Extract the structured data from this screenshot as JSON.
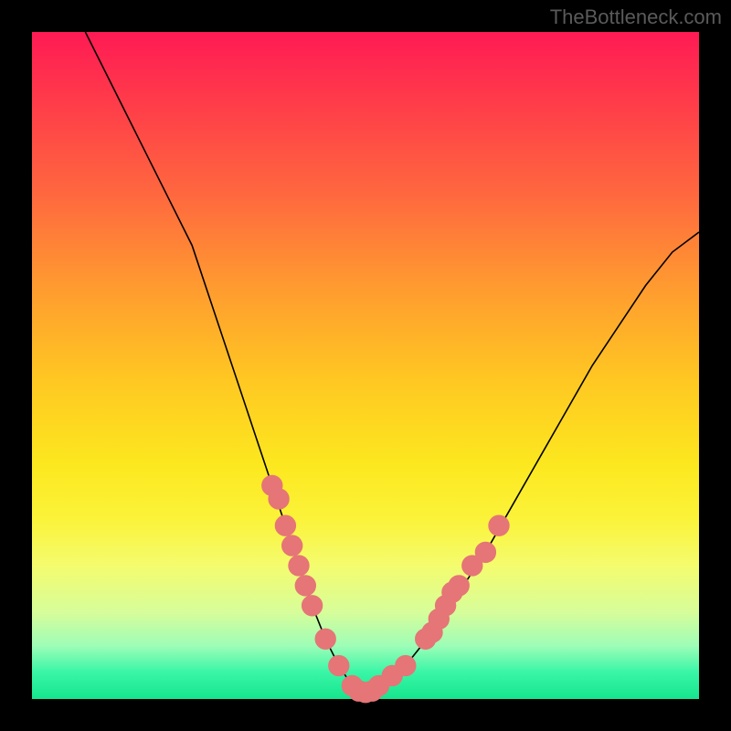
{
  "watermark": "TheBottleneck.com",
  "chart_data": {
    "type": "line",
    "title": "",
    "xlabel": "",
    "ylabel": "",
    "xlim": [
      0,
      100
    ],
    "ylim": [
      0,
      100
    ],
    "series": [
      {
        "name": "curve",
        "x": [
          8,
          12,
          16,
          20,
          24,
          28,
          30,
          32,
          34,
          36,
          38,
          40,
          42,
          44,
          46,
          48,
          50,
          52,
          56,
          60,
          64,
          68,
          72,
          76,
          80,
          84,
          88,
          92,
          96,
          100
        ],
        "y": [
          100,
          92,
          84,
          76,
          68,
          56,
          50,
          44,
          38,
          32,
          26,
          20,
          14,
          9,
          5,
          2,
          1,
          2,
          5,
          10,
          16,
          22,
          29,
          36,
          43,
          50,
          56,
          62,
          67,
          70
        ]
      }
    ],
    "markers": {
      "left_branch": [
        {
          "x": 36,
          "y": 32
        },
        {
          "x": 37,
          "y": 30
        },
        {
          "x": 38,
          "y": 26
        },
        {
          "x": 39,
          "y": 23
        },
        {
          "x": 40,
          "y": 20
        },
        {
          "x": 41,
          "y": 17
        },
        {
          "x": 42,
          "y": 14
        },
        {
          "x": 44,
          "y": 9
        }
      ],
      "bottom": [
        {
          "x": 46,
          "y": 5
        },
        {
          "x": 48,
          "y": 2
        },
        {
          "x": 49,
          "y": 1.2
        },
        {
          "x": 50,
          "y": 1
        },
        {
          "x": 51,
          "y": 1.2
        },
        {
          "x": 52,
          "y": 2
        },
        {
          "x": 54,
          "y": 3.5
        },
        {
          "x": 56,
          "y": 5
        }
      ],
      "right_branch": [
        {
          "x": 59,
          "y": 9
        },
        {
          "x": 60,
          "y": 10
        },
        {
          "x": 61,
          "y": 12
        },
        {
          "x": 62,
          "y": 14
        },
        {
          "x": 63,
          "y": 16
        },
        {
          "x": 64,
          "y": 17
        },
        {
          "x": 66,
          "y": 20
        },
        {
          "x": 68,
          "y": 22
        },
        {
          "x": 70,
          "y": 26
        }
      ]
    },
    "gradient_stops": [
      {
        "pos": 0,
        "color": "#ff1a54"
      },
      {
        "pos": 10,
        "color": "#ff3a4a"
      },
      {
        "pos": 25,
        "color": "#ff6a3e"
      },
      {
        "pos": 38,
        "color": "#ff9a30"
      },
      {
        "pos": 52,
        "color": "#ffc722"
      },
      {
        "pos": 65,
        "color": "#fce81f"
      },
      {
        "pos": 73,
        "color": "#fbf33a"
      },
      {
        "pos": 80,
        "color": "#f4fc6e"
      },
      {
        "pos": 87,
        "color": "#d7fd9a"
      },
      {
        "pos": 92,
        "color": "#9efdb7"
      },
      {
        "pos": 96,
        "color": "#39f6a7"
      },
      {
        "pos": 100,
        "color": "#16e58d"
      }
    ]
  }
}
